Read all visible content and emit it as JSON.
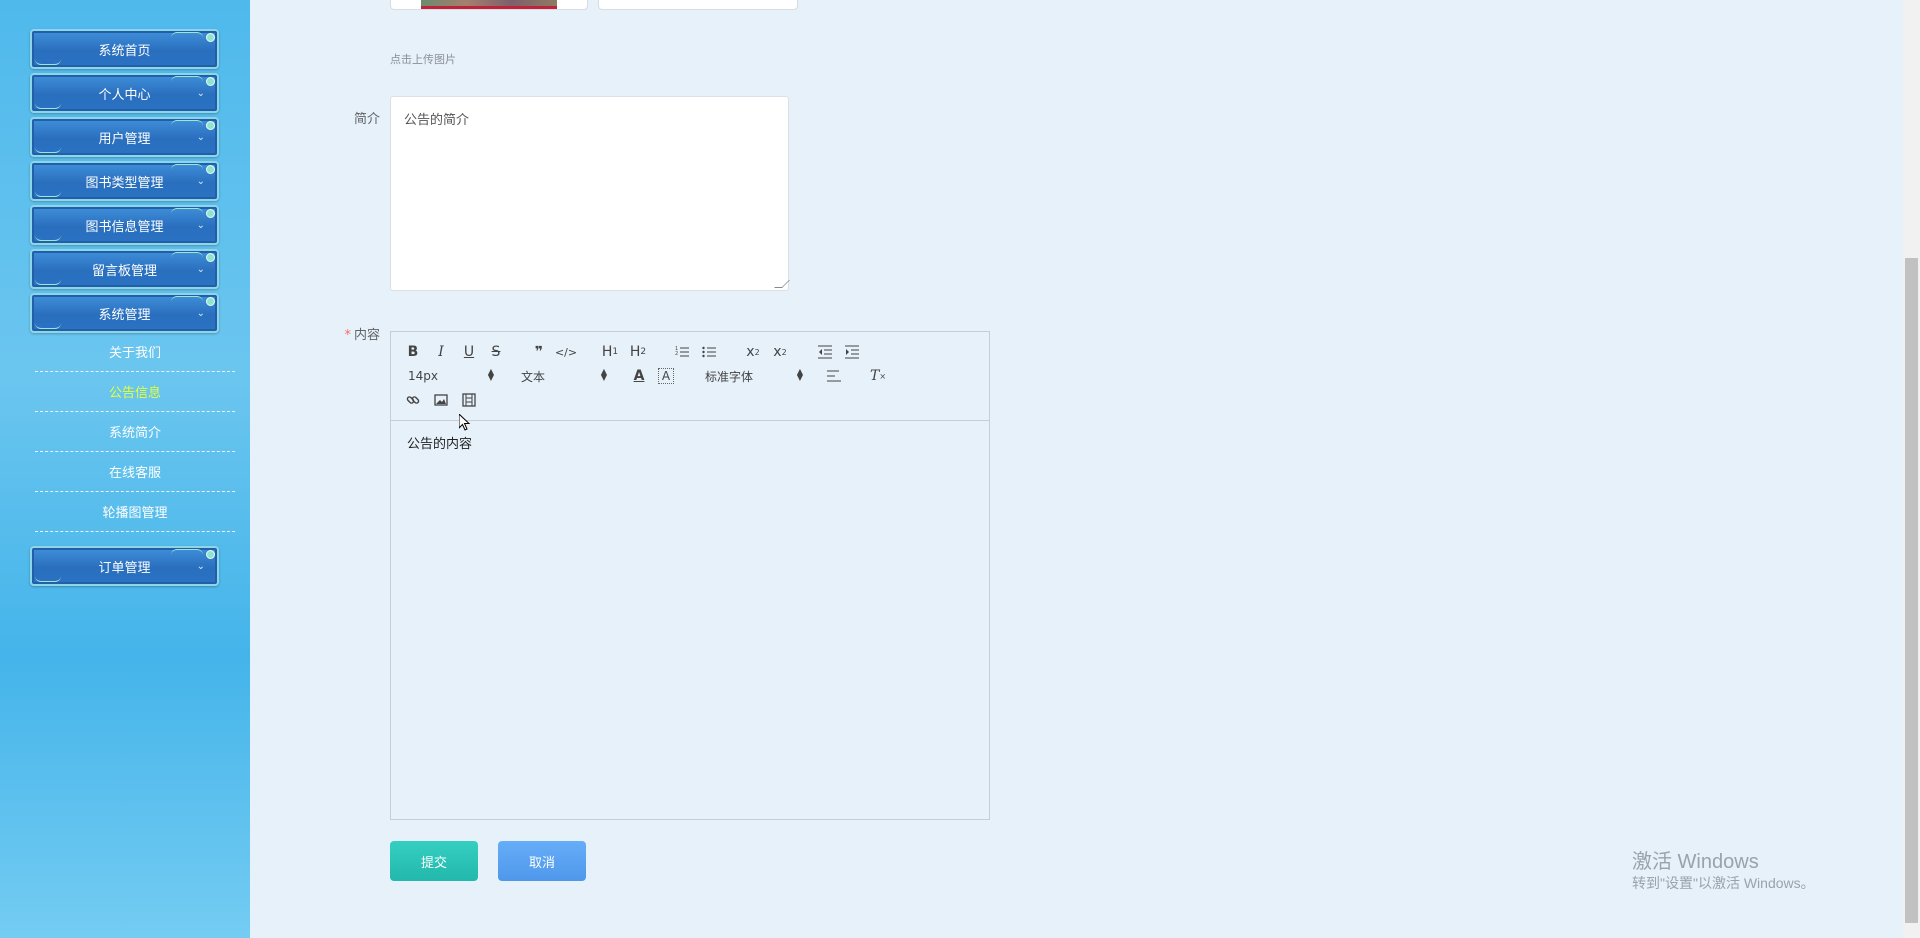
{
  "sidebar": {
    "menus": [
      {
        "label": "系统首页"
      },
      {
        "label": "个人中心"
      },
      {
        "label": "用户管理"
      },
      {
        "label": "图书类型管理"
      },
      {
        "label": "图书信息管理"
      },
      {
        "label": "留言板管理"
      },
      {
        "label": "系统管理"
      }
    ],
    "submenu": [
      {
        "label": "关于我们"
      },
      {
        "label": "公告信息",
        "active": true
      },
      {
        "label": "系统简介"
      },
      {
        "label": "在线客服"
      },
      {
        "label": "轮播图管理"
      }
    ],
    "last_menu": {
      "label": "订单管理"
    }
  },
  "form": {
    "upload_hint": "点击上传图片",
    "intro_label": "简介",
    "intro_value": "公告的简介",
    "content_label": "内容",
    "content_required": "*",
    "editor": {
      "font_size": "14px",
      "heading": "文本",
      "font_family": "标准字体",
      "content": "公告的内容",
      "icons": [
        "bold-icon",
        "italic-icon",
        "underline-icon",
        "strikethrough-icon",
        "blockquote-icon",
        "code-icon",
        "h1-icon",
        "h2-icon",
        "ordered-list-icon",
        "bullet-list-icon",
        "subscript-icon",
        "superscript-icon",
        "outdent-icon",
        "indent-icon",
        "font-color-icon",
        "background-color-icon",
        "align-icon",
        "clear-format-icon",
        "link-icon",
        "image-icon",
        "video-icon"
      ]
    },
    "submit_label": "提交",
    "cancel_label": "取消"
  },
  "watermark": {
    "line1": "激活 Windows",
    "line2": "转到\"设置\"以激活 Windows。"
  }
}
